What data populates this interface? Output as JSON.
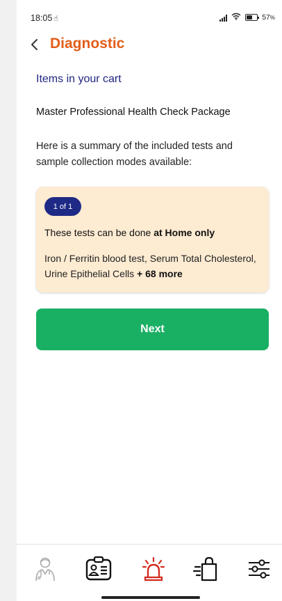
{
  "status_bar": {
    "time": "18:05",
    "battery": "57",
    "battery_level_percent": 57
  },
  "header": {
    "title": "Diagnostic",
    "back_icon": "chevron-left-icon"
  },
  "cart": {
    "section_title": "Items in your cart",
    "package_name": "Master Professional Health Check Package",
    "summary": "Here is a summary of the included tests and sample collection modes available:"
  },
  "test_card": {
    "badge": "1 of 1",
    "mode_prefix": "These tests can be done ",
    "mode_emphasis": "at Home only",
    "tests": "Iron / Ferritin blood test, Serum Total Cholesterol, Urine Epithelial Cells ",
    "more": "+ 68 more"
  },
  "actions": {
    "next_label": "Next"
  },
  "bottom_nav": {
    "items": [
      {
        "icon": "doctor-icon",
        "active": false
      },
      {
        "icon": "id-card-icon",
        "active": false
      },
      {
        "icon": "emergency-alarm-icon",
        "active": true
      },
      {
        "icon": "shopping-bag-icon",
        "active": false
      },
      {
        "icon": "settings-sliders-icon",
        "active": false
      }
    ]
  },
  "colors": {
    "accent": "#e25d18",
    "brand_blue": "#1f2a86",
    "cta_green": "#1ab064",
    "card_bg": "#fdebd2",
    "alert_red": "#d42b1e"
  }
}
